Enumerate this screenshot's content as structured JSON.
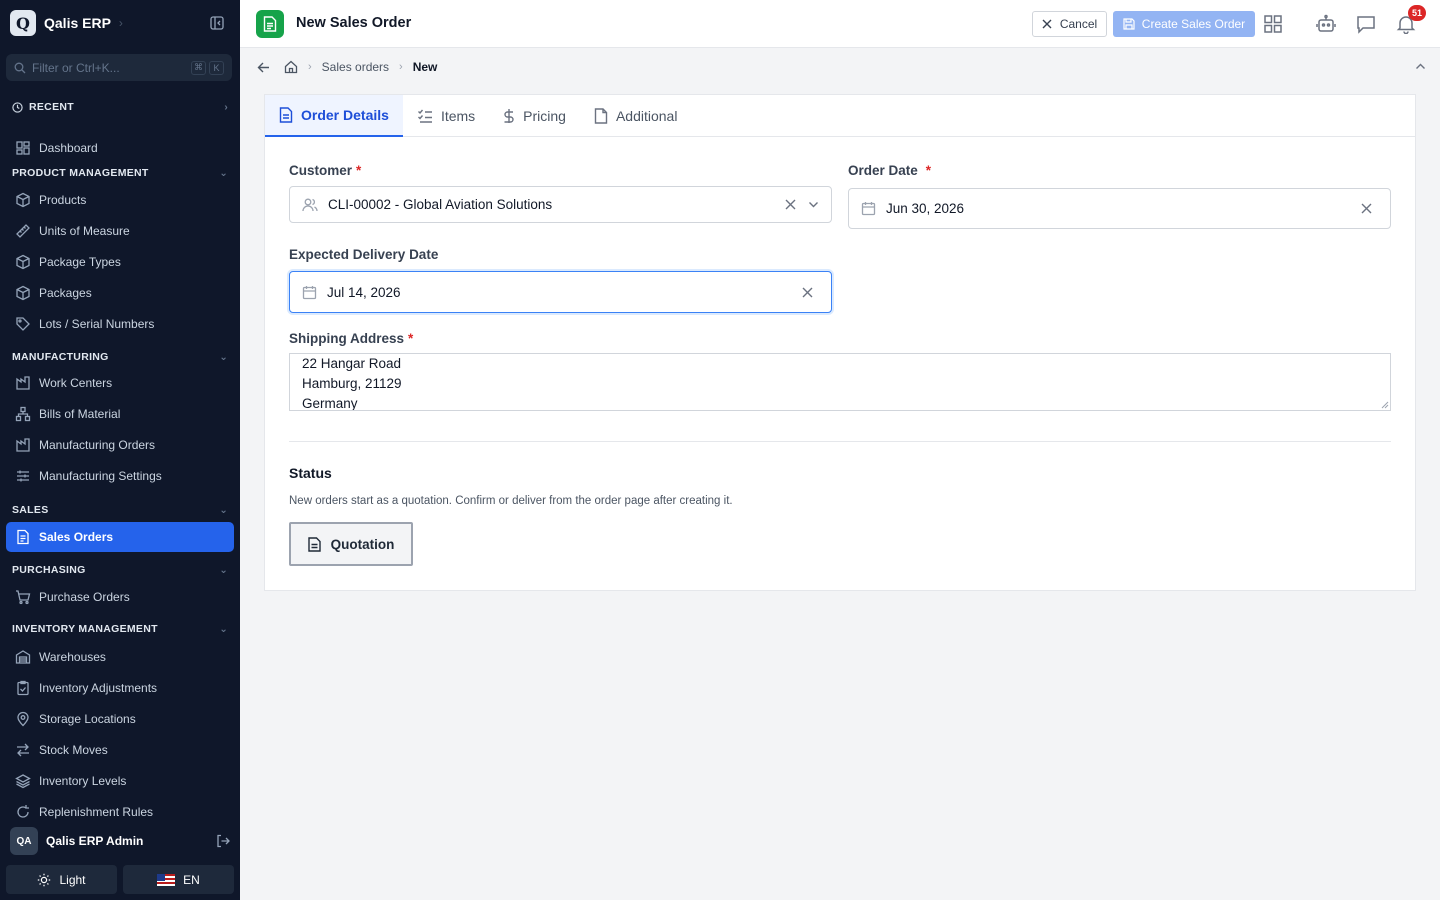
{
  "app": {
    "logo_letter": "Q",
    "name": "Qalis ERP"
  },
  "sidebar": {
    "filter_placeholder": "Filter or Ctrl+K...",
    "shortcut_keys": [
      "⌘",
      "K"
    ],
    "recent_label": "RECENT",
    "dashboard_label": "Dashboard",
    "sections": {
      "product": "PRODUCT MANAGEMENT",
      "manufacturing": "MANUFACTURING",
      "sales": "SALES",
      "purchasing": "PURCHASING",
      "inventory": "INVENTORY MANAGEMENT"
    },
    "items": {
      "products": "Products",
      "uom": "Units of Measure",
      "package_types": "Package Types",
      "packages": "Packages",
      "lots": "Lots / Serial Numbers",
      "work_centers": "Work Centers",
      "bom": "Bills of Material",
      "mo": "Manufacturing Orders",
      "mfg_settings": "Manufacturing Settings",
      "sales_orders": "Sales Orders",
      "purchase_orders": "Purchase Orders",
      "warehouses": "Warehouses",
      "inv_adjust": "Inventory Adjustments",
      "storage": "Storage Locations",
      "stock_moves": "Stock Moves",
      "inv_levels": "Inventory Levels",
      "replenish": "Replenishment Rules"
    },
    "user": {
      "initials": "QA",
      "name": "Qalis ERP Admin"
    },
    "theme_label": "Light",
    "lang_label": "EN"
  },
  "header": {
    "title": "New Sales Order",
    "cancel_label": "Cancel",
    "create_label": "Create Sales Order",
    "notification_count": "51"
  },
  "breadcrumb": {
    "parent": "Sales orders",
    "current": "New"
  },
  "tabs": [
    "Order Details",
    "Items",
    "Pricing",
    "Additional"
  ],
  "form": {
    "customer_label": "Customer",
    "customer_value": "CLI-00002 - Global Aviation Solutions",
    "order_date_label": "Order Date",
    "order_date_value": "Jun 30, 2026",
    "delivery_label": "Expected Delivery Date",
    "delivery_value": "Jul 14, 2026",
    "shipping_label": "Shipping Address",
    "shipping_lines": [
      "22 Hangar Road",
      "Hamburg, 21129",
      "Germany"
    ],
    "required_mark": "*"
  },
  "status": {
    "title": "Status",
    "help": "New orders start as a quotation. Confirm or deliver from the order page after creating it.",
    "button_label": "Quotation"
  }
}
